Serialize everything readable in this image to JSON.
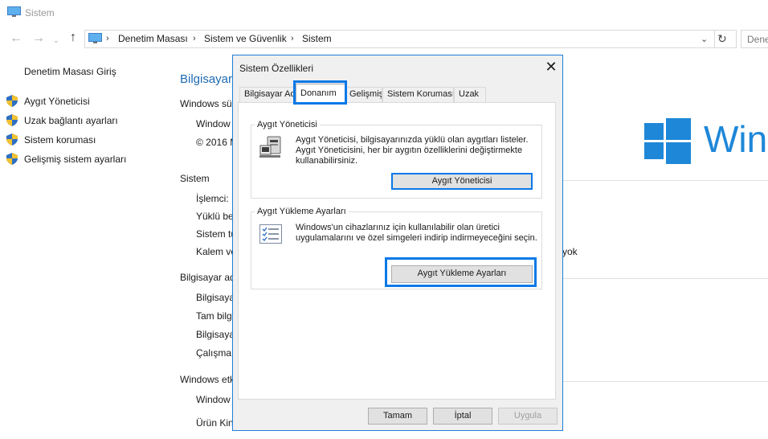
{
  "window": {
    "title": "Sistem",
    "breadcrumb": [
      "Denetim Masası",
      "Sistem ve Güvenlik",
      "Sistem"
    ],
    "search_placeholder": "Dene"
  },
  "sidebar": {
    "home": "Denetim Masası Giriş",
    "items": [
      {
        "label": "Aygıt Yöneticisi",
        "icon": "shield-icon"
      },
      {
        "label": "Uzak bağlantı ayarları",
        "icon": "shield-icon"
      },
      {
        "label": "Sistem koruması",
        "icon": "shield-icon"
      },
      {
        "label": "Gelişmiş sistem ayarları",
        "icon": "shield-icon"
      }
    ]
  },
  "main": {
    "heading": "Bilgisayar",
    "sections": [
      {
        "title": "Windows sü",
        "rows": [
          "Window",
          "© 2016 M"
        ]
      },
      {
        "title": "Sistem",
        "rows": [
          "İşlemci:",
          "Yüklü be",
          "Sistem tü",
          "Kalem ve"
        ]
      },
      {
        "title": "Bilgisayar ad",
        "rows": [
          "Bilgisaya",
          "Tam bilg",
          "Bilgisaya",
          "Çalışma"
        ]
      },
      {
        "title": "Windows etk",
        "rows": [
          "Window",
          "Ürün Kin"
        ]
      }
    ],
    "partial_value": "yok",
    "brand_text": "Win"
  },
  "dialog": {
    "title": "Sistem Özellikleri",
    "tabs": [
      "Bilgisayar Adı",
      "Donanım",
      "Gelişmiş",
      "Sistem Koruması",
      "Uzak"
    ],
    "active_tab": "Donanım",
    "device_manager": {
      "title": "Aygıt Yöneticisi",
      "description": [
        "Aygıt Yöneticisi, bilgisayarınızda yüklü olan aygıtları listeler.",
        "Aygıt Yöneticisini, her bir aygıtın özelliklerini değiştirmekte",
        "kullanabilirsiniz."
      ],
      "button": "Aygıt Yöneticisi"
    },
    "device_install": {
      "title": "Aygıt Yükleme Ayarları",
      "description": [
        "Windows'un cihazlarınız için kullanılabilir olan üretici",
        "uygulamalarını ve özel simgeleri indirip indirmeyeceğini seçin."
      ],
      "button": "Aygıt Yükleme Ayarları"
    },
    "buttons": {
      "ok": "Tamam",
      "cancel": "İptal",
      "apply": "Uygula"
    }
  },
  "colors": {
    "accent": "#0a79e8",
    "windows_blue": "#1e87d8",
    "link": "#1e6ab2"
  }
}
